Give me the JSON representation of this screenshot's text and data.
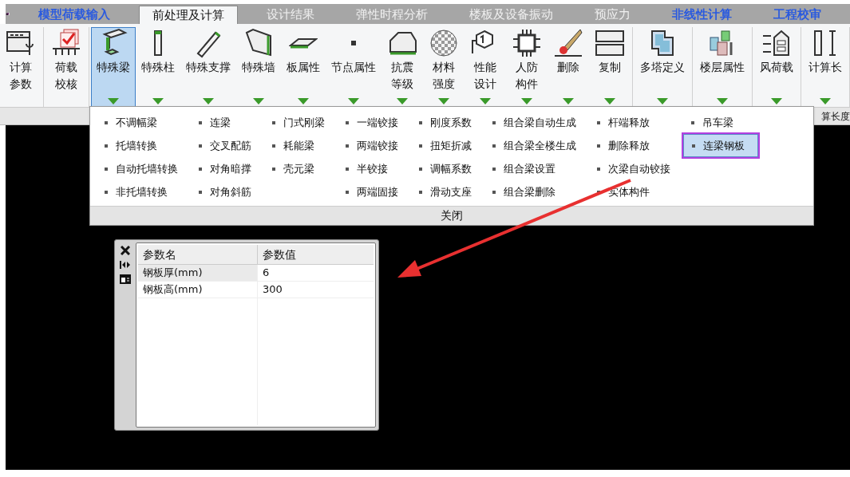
{
  "tabs": [
    {
      "label": "模型荷载输入",
      "selected": false,
      "emphasis": true
    },
    {
      "label": "前处理及计算",
      "selected": true,
      "emphasis": false
    },
    {
      "label": "设计结果",
      "selected": false,
      "emphasis": false
    },
    {
      "label": "弹性时程分析",
      "selected": false,
      "emphasis": false
    },
    {
      "label": "楼板及设备振动",
      "selected": false,
      "emphasis": false
    },
    {
      "label": "预应力",
      "selected": false,
      "emphasis": false
    },
    {
      "label": "非线性计算",
      "selected": false,
      "emphasis": true
    },
    {
      "label": "工程校审",
      "selected": false,
      "emphasis": true
    }
  ],
  "ribbon_groups": [
    {
      "buttons": [
        {
          "lines": [
            "计算",
            "参数"
          ],
          "dropdown": false,
          "selected": false
        }
      ]
    },
    {
      "buttons": [
        {
          "lines": [
            "荷载",
            "校核"
          ],
          "dropdown": false,
          "selected": false
        }
      ]
    },
    {
      "buttons": [
        {
          "lines": [
            "特殊梁"
          ],
          "dropdown": true,
          "selected": true
        },
        {
          "lines": [
            "特殊柱"
          ],
          "dropdown": true,
          "selected": false
        },
        {
          "lines": [
            "特殊支撑"
          ],
          "dropdown": true,
          "selected": false
        },
        {
          "lines": [
            "特殊墙"
          ],
          "dropdown": true,
          "selected": false
        },
        {
          "lines": [
            "板属性"
          ],
          "dropdown": true,
          "selected": false
        },
        {
          "lines": [
            "节点属性"
          ],
          "dropdown": true,
          "selected": false
        },
        {
          "lines": [
            "抗震",
            "等级"
          ],
          "dropdown": true,
          "selected": false
        },
        {
          "lines": [
            "材料",
            "强度"
          ],
          "dropdown": true,
          "selected": false
        },
        {
          "lines": [
            "性能",
            "设计"
          ],
          "dropdown": true,
          "selected": false
        },
        {
          "lines": [
            "人防",
            "构件"
          ],
          "dropdown": true,
          "selected": false
        },
        {
          "lines": [
            "删除"
          ],
          "dropdown": true,
          "selected": false
        },
        {
          "lines": [
            "复制"
          ],
          "dropdown": true,
          "selected": false
        }
      ]
    },
    {
      "buttons": [
        {
          "lines": [
            "多塔定义"
          ],
          "dropdown": true,
          "selected": false
        }
      ]
    },
    {
      "buttons": [
        {
          "lines": [
            "楼层属性"
          ],
          "dropdown": true,
          "selected": false
        }
      ]
    },
    {
      "buttons": [
        {
          "lines": [
            "风荷载"
          ],
          "dropdown": true,
          "selected": false
        }
      ]
    },
    {
      "buttons": [
        {
          "lines": [
            "计算长"
          ],
          "dropdown": true,
          "selected": false
        }
      ]
    }
  ],
  "group_label_fragment": "算长度",
  "dropdown_menu": {
    "columns": [
      [
        {
          "label": "不调幅梁",
          "selected": false
        },
        {
          "label": "托墙转换",
          "selected": false
        },
        {
          "label": "自动托墙转换",
          "selected": false
        },
        {
          "label": "非托墙转换",
          "selected": false
        }
      ],
      [
        {
          "label": "连梁",
          "selected": false
        },
        {
          "label": "交叉配筋",
          "selected": false
        },
        {
          "label": "对角暗撑",
          "selected": false
        },
        {
          "label": "对角斜筋",
          "selected": false
        }
      ],
      [
        {
          "label": "门式刚梁",
          "selected": false
        },
        {
          "label": "耗能梁",
          "selected": false
        },
        {
          "label": "壳元梁",
          "selected": false
        }
      ],
      [
        {
          "label": "一端铰接",
          "selected": false
        },
        {
          "label": "两端铰接",
          "selected": false
        },
        {
          "label": "半铰接",
          "selected": false
        },
        {
          "label": "两端固接",
          "selected": false
        }
      ],
      [
        {
          "label": "刚度系数",
          "selected": false
        },
        {
          "label": "扭矩折减",
          "selected": false
        },
        {
          "label": "调幅系数",
          "selected": false
        },
        {
          "label": "滑动支座",
          "selected": false
        }
      ],
      [
        {
          "label": "组合梁自动生成",
          "selected": false
        },
        {
          "label": "组合梁全楼生成",
          "selected": false
        },
        {
          "label": "组合梁设置",
          "selected": false
        },
        {
          "label": "组合梁删除",
          "selected": false
        }
      ],
      [
        {
          "label": "杆端释放",
          "selected": false
        },
        {
          "label": "删除释放",
          "selected": false
        },
        {
          "label": "次梁自动铰接",
          "selected": false
        },
        {
          "label": "实体构件",
          "selected": false
        }
      ],
      [
        {
          "label": "吊车梁",
          "selected": false
        },
        {
          "label": "连梁钢板",
          "selected": true
        }
      ]
    ],
    "close_label": "关闭"
  },
  "parameter_panel": {
    "columns": [
      "参数名",
      "参数值"
    ],
    "rows": [
      {
        "name": "钢板厚(mm)",
        "value": "6",
        "selected": true
      },
      {
        "name": "钢板高(mm)",
        "value": "300",
        "selected": false
      }
    ]
  }
}
